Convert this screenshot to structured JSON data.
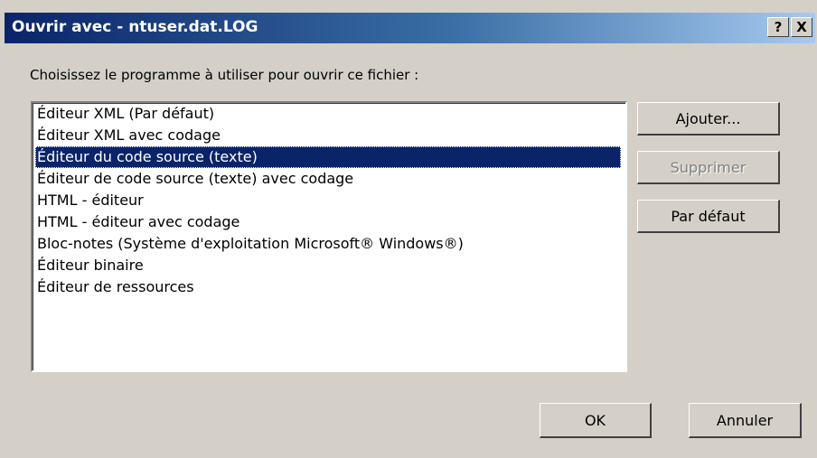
{
  "window": {
    "title": "Ouvrir avec - ntuser.dat.LOG",
    "help_label": "?",
    "close_label": "X"
  },
  "prompt": "Choisissez le programme à utiliser pour ouvrir ce fichier :",
  "programs": [
    {
      "label": "Éditeur XML (Par défaut)",
      "selected": false
    },
    {
      "label": "Éditeur XML avec codage",
      "selected": false
    },
    {
      "label": "Éditeur du code source (texte)",
      "selected": true
    },
    {
      "label": "Éditeur de code source (texte) avec codage",
      "selected": false
    },
    {
      "label": "HTML - éditeur",
      "selected": false
    },
    {
      "label": "HTML - éditeur avec codage",
      "selected": false
    },
    {
      "label": "Bloc-notes (Système d'exploitation Microsoft® Windows®)",
      "selected": false
    },
    {
      "label": "Éditeur binaire",
      "selected": false
    },
    {
      "label": "Éditeur de ressources",
      "selected": false
    }
  ],
  "buttons": {
    "add": "Ajouter...",
    "remove": "Supprimer",
    "default": "Par défaut",
    "ok": "OK",
    "cancel": "Annuler"
  },
  "colors": {
    "title_gradient_start": "#0a246a",
    "title_gradient_end": "#a6caf0",
    "selection": "#0a246a",
    "dialog_face": "#d4d0c8"
  }
}
